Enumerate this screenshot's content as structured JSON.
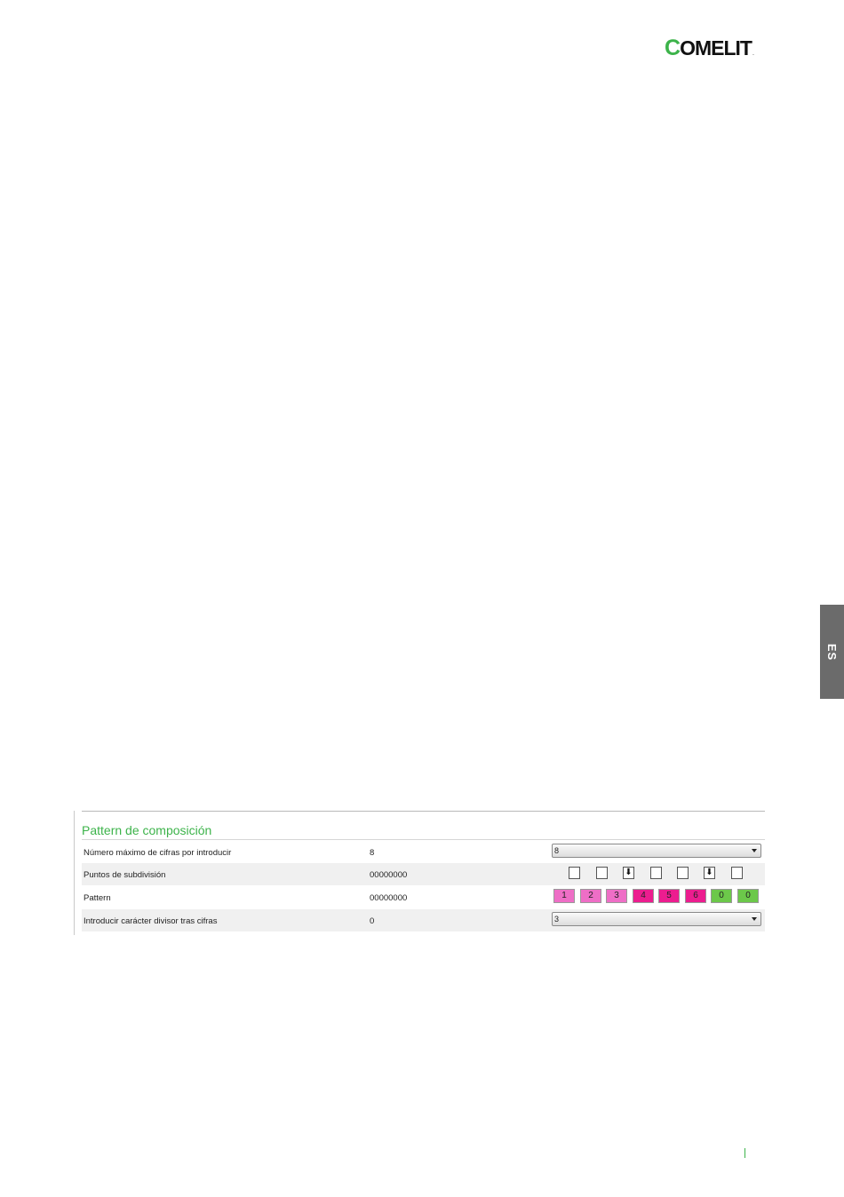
{
  "brand": {
    "logo_c": "C",
    "logo_rest": "OMELIT",
    "logo_dot": ".",
    "colors": {
      "green": "#3cb34a",
      "dark": "#111111"
    }
  },
  "lang_tab": {
    "label": "ES",
    "color": "#6b6b6b"
  },
  "panel": {
    "title": "Pattern de composición",
    "rows": [
      {
        "label": "Número máximo de cifras por introducir",
        "value": "8",
        "control": "select",
        "selected": "8"
      },
      {
        "label": "Puntos de subdivisión",
        "value": "00000000",
        "control": "checkboxes",
        "checks": [
          {
            "checked": false,
            "glyph": ""
          },
          {
            "checked": false,
            "glyph": ""
          },
          {
            "checked": true,
            "glyph": "⬇"
          },
          {
            "checked": false,
            "glyph": ""
          },
          {
            "checked": false,
            "glyph": ""
          },
          {
            "checked": true,
            "glyph": "⬇"
          },
          {
            "checked": false,
            "glyph": ""
          }
        ]
      },
      {
        "label": "Pattern",
        "value": "00000000",
        "control": "digits",
        "digits": [
          {
            "text": "1",
            "color": "#ee6ec6"
          },
          {
            "text": "2",
            "color": "#ee6ec6"
          },
          {
            "text": "3",
            "color": "#ee6ec6"
          },
          {
            "text": "4",
            "color": "#ec1d8f"
          },
          {
            "text": "5",
            "color": "#ec1d8f"
          },
          {
            "text": "6",
            "color": "#ec1d8f"
          },
          {
            "text": "0",
            "color": "#6cc84a"
          },
          {
            "text": "0",
            "color": "#6cc84a"
          }
        ]
      },
      {
        "label": "Introducir carácter divisor tras cifras",
        "value": "0",
        "control": "select",
        "selected": "3"
      }
    ]
  }
}
